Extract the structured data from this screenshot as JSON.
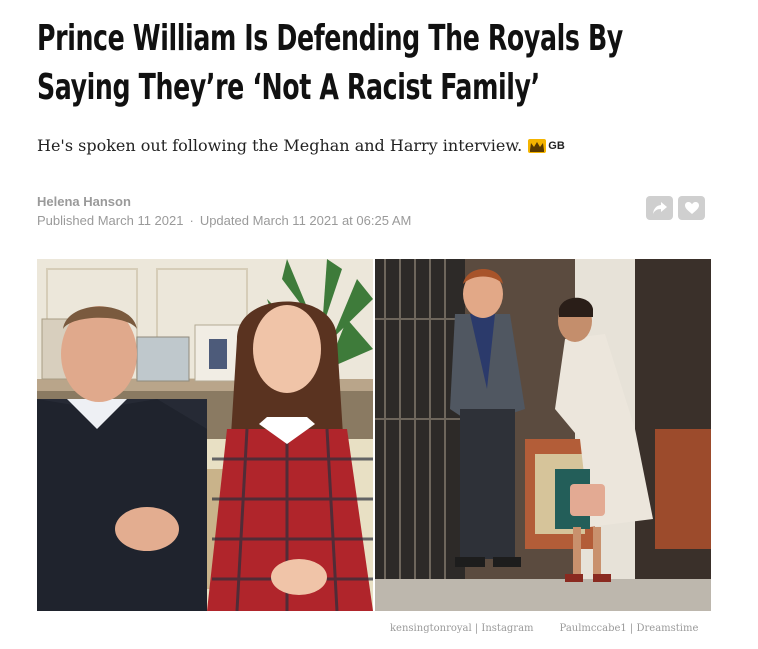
{
  "article": {
    "headline": "Prince William Is Defending The Royals By Saying They’re ‘Not A Racist Family’",
    "subheadline": "He's spoken out following the Meghan and Harry interview.",
    "edition_badge": {
      "icon": "crown-icon",
      "code": "GB"
    },
    "author": "Helena Hanson",
    "published": "Published March 11 2021",
    "updated": "Updated March 11 2021 at 06:25 AM",
    "date_separator": "·"
  },
  "actions": {
    "share_icon": "share-icon",
    "save_icon": "heart-icon"
  },
  "photo": {
    "credits": [
      "kensingtonroyal | Instagram",
      "Paulmccabe1 | Dreamstime"
    ]
  },
  "colors": {
    "headline": "#111111",
    "meta": "#9a9a9a",
    "action_button": "#cfcfcf",
    "tartan_red": "#b0252b"
  }
}
